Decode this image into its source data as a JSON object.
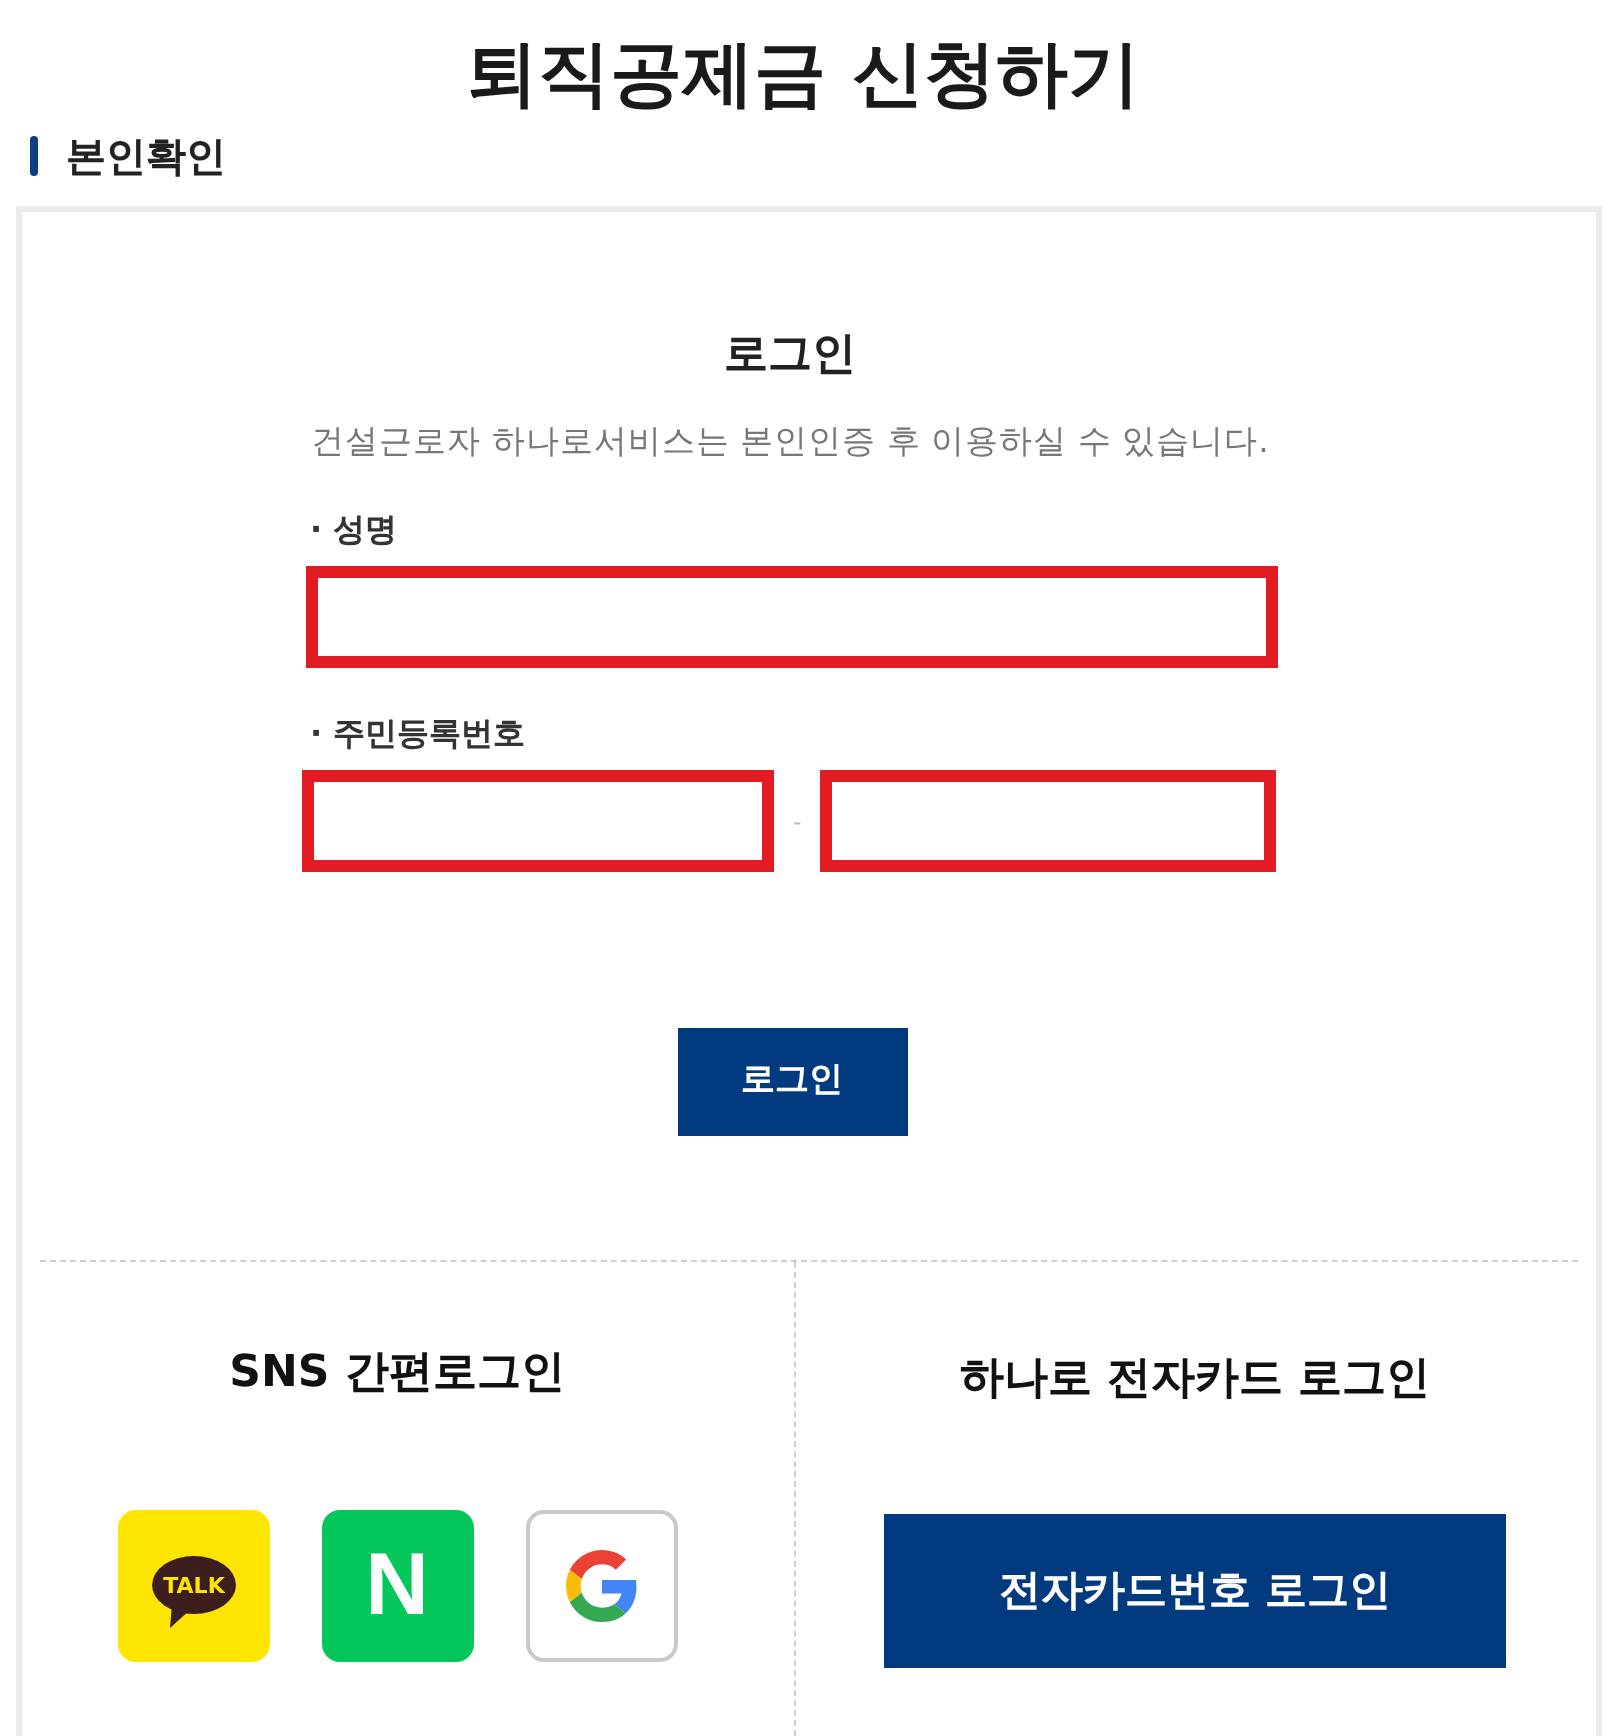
{
  "page": {
    "title": "퇴직공제금 신청하기"
  },
  "section": {
    "title": "본인확인"
  },
  "login": {
    "title": "로그인",
    "description": "건설근로자 하나로서비스는 본인인증 후 이용하실 수 있습니다.",
    "fields": [
      {
        "label": "· 성명",
        "inputs": [
          {
            "highlighted": true
          }
        ]
      },
      {
        "label": "· 주민등록번호",
        "separator": "-",
        "inputs": [
          {
            "highlighted": true
          },
          {
            "highlighted": true
          }
        ]
      }
    ],
    "submit": "로그인"
  },
  "sns": {
    "title": "SNS 간편로그인",
    "providers": [
      {
        "kind": "kakao",
        "label": "TALK"
      },
      {
        "kind": "naver",
        "label": "N"
      },
      {
        "kind": "google"
      }
    ]
  },
  "card_login": {
    "title": "하나로 전자카드 로그인",
    "button": "전자카드번호 로그인"
  }
}
